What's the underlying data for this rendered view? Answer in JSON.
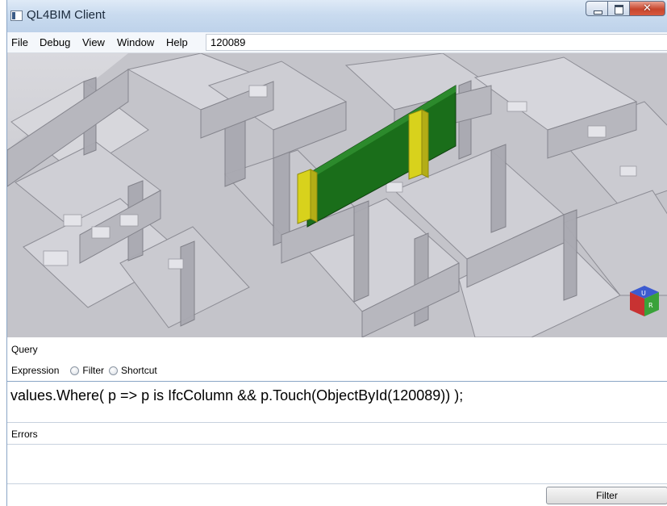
{
  "window": {
    "title": "QL4BIM Client"
  },
  "menu": {
    "items": [
      "File",
      "Debug",
      "View",
      "Window",
      "Help"
    ],
    "object_id_value": "120089"
  },
  "viewport": {
    "icon": "view-cube-icon",
    "highlight_colors": {
      "wall": "#1a6e1a",
      "columns": "#d8d21c"
    }
  },
  "query": {
    "section_label": "Query",
    "expression_label": "Expression",
    "radio_options": [
      "Filter",
      "Shortcut"
    ],
    "expression_text": "values.Where( p => p is IfcColumn && p.Touch(ObjectById(120089)) );"
  },
  "errors": {
    "label": "Errors",
    "text": ""
  },
  "actions": {
    "filter_button_label": "Filter"
  }
}
